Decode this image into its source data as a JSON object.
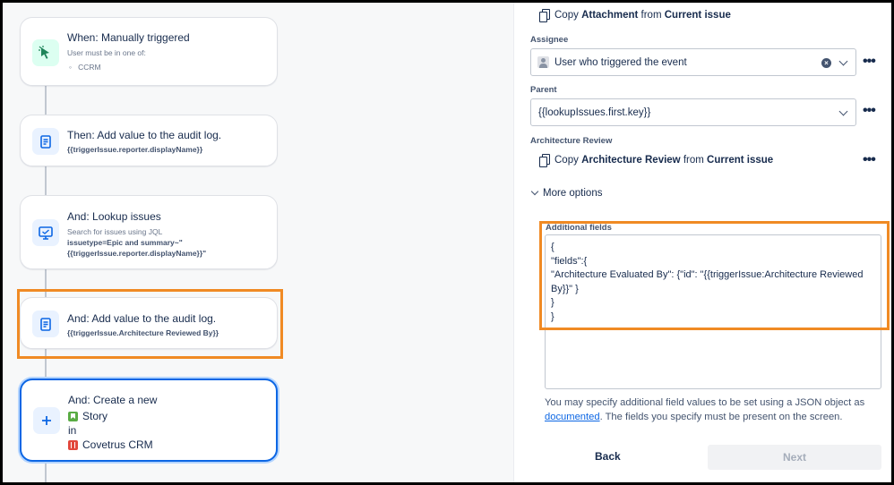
{
  "flow": {
    "trigger": {
      "title": "When: Manually triggered",
      "subtitle": "User must be in one of:",
      "item": "CCRM"
    },
    "step1": {
      "title": "Then: Add value to the audit log.",
      "detail": "{{triggerIssue.reporter.displayName}}"
    },
    "step2": {
      "title": "And: Lookup issues",
      "subtitle": "Search for issues using JQL",
      "jql_line1": "issuetype=Epic and summary~\"",
      "jql_line2": "{{triggerIssue.reporter.displayName}}\""
    },
    "step3": {
      "title": "And: Add value to the audit log.",
      "detail": "{{triggerIssue.Architecture Reviewed By}}"
    },
    "step4": {
      "title": "And: Create a new",
      "issue_type": "Story",
      "in_label": "in",
      "project": "Covetrus CRM"
    }
  },
  "form": {
    "copy_attachment": {
      "prefix": "Copy",
      "field": "Attachment",
      "from_word": "from",
      "source": "Current issue"
    },
    "assignee": {
      "label": "Assignee",
      "value": "User who triggered the event"
    },
    "parent": {
      "label": "Parent",
      "value": "{{lookupIssues.first.key}}"
    },
    "architecture_review": {
      "label": "Architecture Review",
      "prefix": "Copy",
      "field": "Architecture Review",
      "from_word": "from",
      "source": "Current issue"
    },
    "more_options": "More options",
    "additional_fields": {
      "label": "Additional fields",
      "value": "{\n\"fields\":{\n\"Architecture Evaluated By\": {\"id\": \"{{triggerIssue:Architecture Reviewed By}}\" }\n}\n}"
    },
    "help_text_before": "You may specify additional field values to be set using a JSON object as ",
    "help_link": "documented",
    "help_text_after": ". The fields you specify must be present on the screen.",
    "back_button": "Back",
    "next_button": "Next"
  },
  "colors": {
    "highlight": "#f08a24",
    "selected": "#0c66e4",
    "link": "#0c66e4"
  }
}
